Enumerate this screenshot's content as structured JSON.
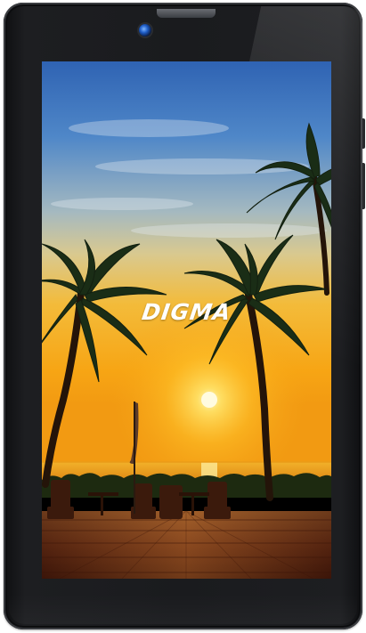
{
  "device": {
    "brand_logo": "DIGMA",
    "camera_icon": "front-camera-icon",
    "colors": {
      "bezel": "#1a1b1e",
      "frame": "#3a3c40",
      "camera_lens": "#1f5ec8"
    }
  },
  "wallpaper": {
    "scene": "tropical-beach-sunset",
    "colors": {
      "sky_top": "#3f78c4",
      "sky_mid": "#c9c69a",
      "sun_glow": "#ffcf2a",
      "sea": "#f6a416",
      "deck": "#6a2b14"
    }
  }
}
